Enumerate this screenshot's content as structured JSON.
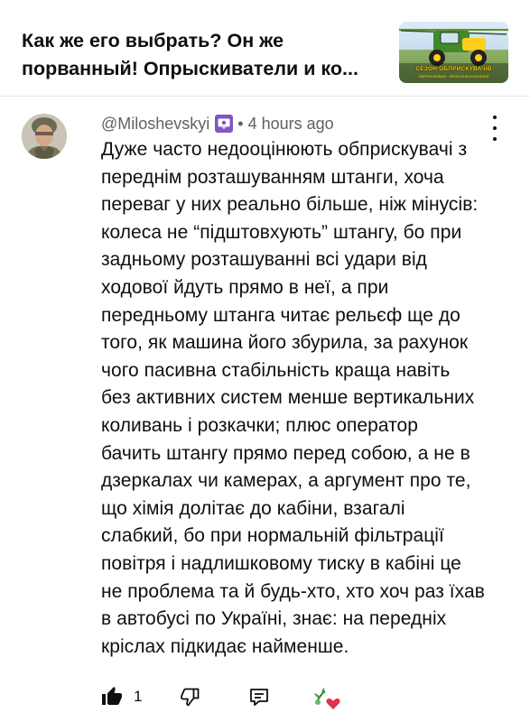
{
  "video": {
    "title": "Как же его выбрать? Он же порванный! Опрыскиватели и ко...",
    "thumbnail": {
      "caption": "СЕЗОН ОБПРИСКУВАЧІВ",
      "subcaption": "ОБПРИСКУВАЧІ · ФРОНТАЛЬНІ ШТАНГИ"
    }
  },
  "comment": {
    "author": "@Miloshevskyi",
    "separator": "•",
    "time": "4 hours ago",
    "text": "Дуже часто недооцінюють обприскувачі з\nпереднім розташуванням штанги, хоча\nпереваг у них реально більше, ніж мінусів:\nколеса не “підштовхують” штангу, бо при\nзадньому розташуванні всі удари від\nходової йдуть прямо в неї, а при\nпередньому штанга читає рельєф ще до\nтого, як машина його збурила, за рахунок\nчого пасивна стабільність краща навіть\nбез активних систем  менше вертикальних\nколивань і розкачки; плюс оператор\nбачить штангу прямо перед собою, а не в\nдзеркалах чи камерах, а аргумент про те,\nщо хімія долітає до кабіни, взагалі\nслабкий, бо при нормальній фільтрації\nповітря і надлишковому тиску в кабіні це\nне проблема та й будь-хто, хто хоч раз їхав\nв автобусі по Україні, знає: на передніх\nкріслах підкидає найменше.",
    "like_count": "1"
  },
  "icons": {
    "avatar": "avatar-soldier",
    "badge": "member-badge-icon",
    "more": "more-vert-icon",
    "like": "thumbs-up-filled-icon",
    "dislike": "thumbs-down-icon",
    "reply": "reply-comment-icon",
    "hearted": "creator-heart-icon"
  },
  "colors": {
    "badge": "#7e57c2",
    "meta_text": "#606060",
    "heart": "#e3304b"
  }
}
